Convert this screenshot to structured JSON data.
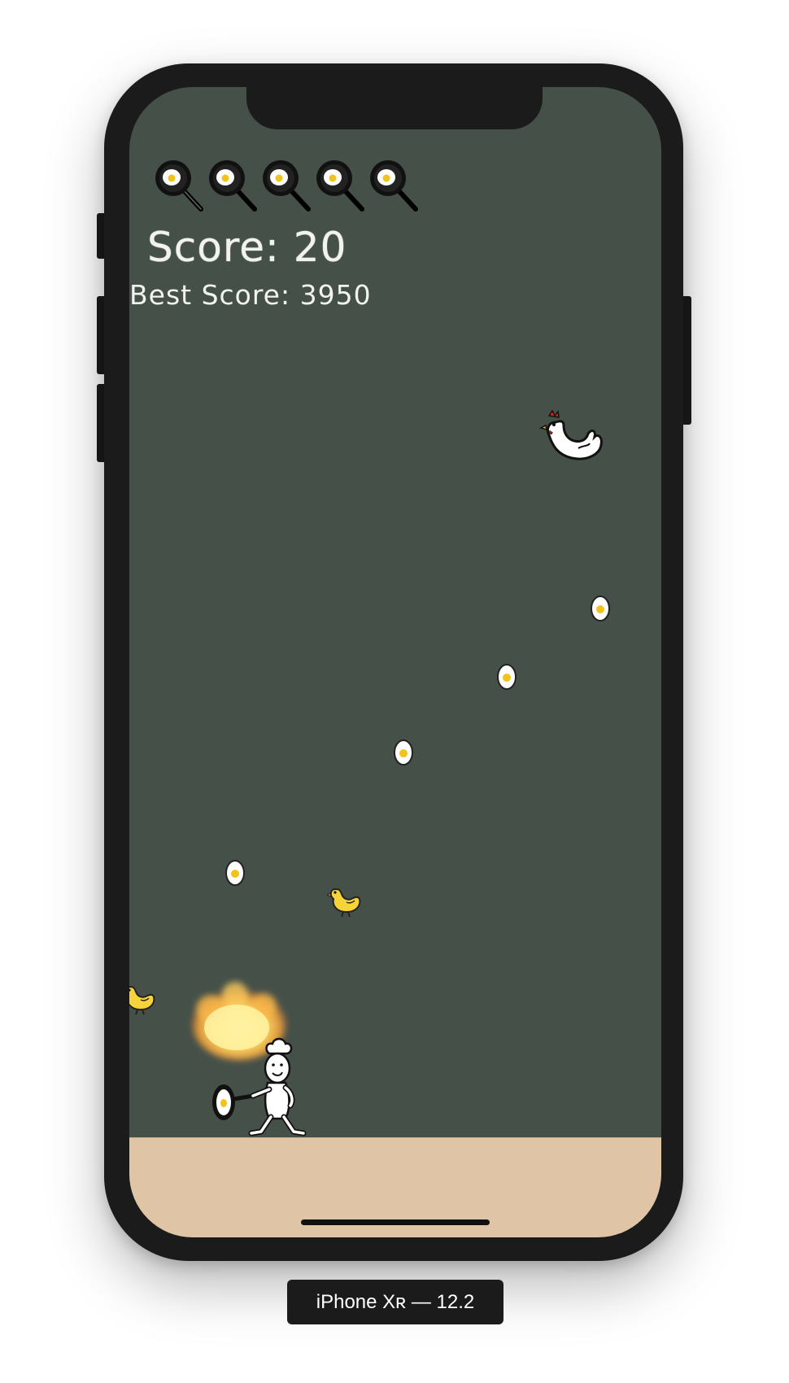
{
  "game": {
    "score_text": "Score: 20",
    "best_score_text": "Best Score: 3950",
    "lives": [
      "frying-pan-egg-icon",
      "frying-pan-egg-icon",
      "frying-pan-egg-icon",
      "frying-pan-egg-icon",
      "frying-pan-egg-icon"
    ]
  },
  "device": {
    "label": "iPhone Xʀ — 12.2"
  },
  "colors": {
    "background": "#455049",
    "ground": "#dfc4a6",
    "text": "#f2f2ee",
    "frame": "#1b1b1b"
  }
}
